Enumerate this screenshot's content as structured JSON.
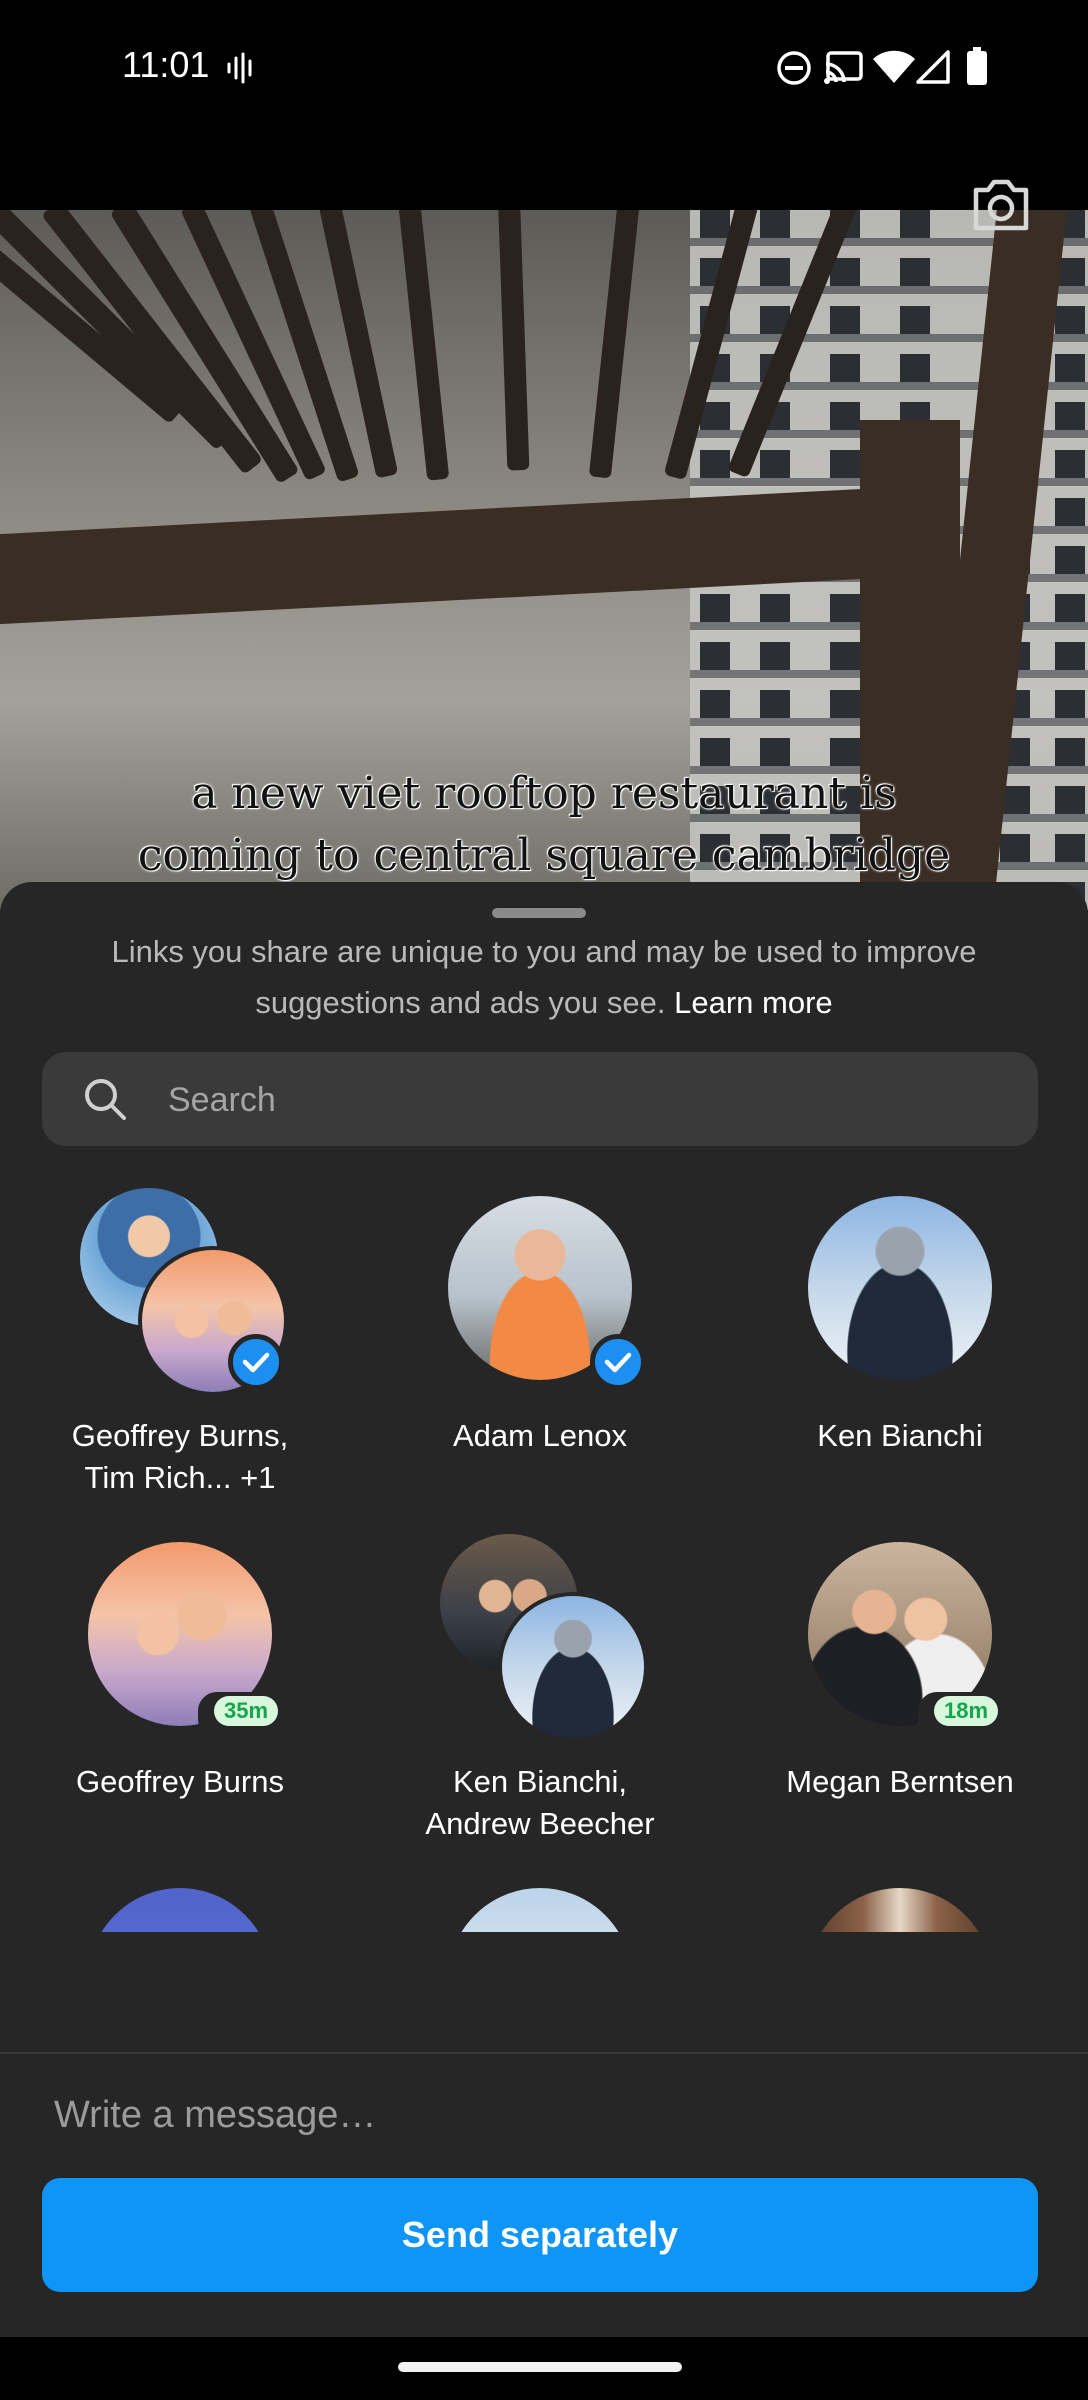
{
  "status_bar": {
    "time": "11:01",
    "icons": [
      "voice-wave-icon",
      "do-not-disturb-icon",
      "cast-icon",
      "wifi-icon",
      "signal-icon",
      "battery-icon"
    ]
  },
  "media": {
    "caption_line1": "a new viet rooftop restaurant is",
    "caption_line2": "coming to central square cambridge",
    "camera_icon": "camera-icon"
  },
  "share_sheet": {
    "notice_text": "Links you share are unique to you and may be used to improve suggestions and ads you see.",
    "learn_more": "Learn more",
    "search_placeholder": "Search",
    "contacts": [
      {
        "name_line1": "Geoffrey Burns,",
        "name_line2": "Tim Rich... +1",
        "selected": true,
        "group": true
      },
      {
        "name_line1": "Adam Lenox",
        "name_line2": "",
        "selected": true,
        "group": false
      },
      {
        "name_line1": "Ken Bianchi",
        "name_line2": "",
        "selected": false,
        "group": false
      },
      {
        "name_line1": "Geoffrey Burns",
        "name_line2": "",
        "selected": false,
        "group": false,
        "active_badge": "35m"
      },
      {
        "name_line1": "Ken Bianchi,",
        "name_line2": "Andrew Beecher",
        "selected": false,
        "group": true
      },
      {
        "name_line1": "Megan Berntsen",
        "name_line2": "",
        "selected": false,
        "group": false,
        "active_badge": "18m"
      },
      {
        "name_line1": "",
        "name_line2": "",
        "selected": false,
        "group": false
      },
      {
        "name_line1": "",
        "name_line2": "",
        "selected": false,
        "group": false
      },
      {
        "name_line1": "",
        "name_line2": "",
        "selected": false,
        "group": false
      }
    ],
    "message_placeholder": "Write a message…",
    "send_button": "Send separately"
  },
  "colors": {
    "sheet_bg": "#262626",
    "accent_blue": "#0f95f6",
    "active_green": "#12a84a"
  }
}
